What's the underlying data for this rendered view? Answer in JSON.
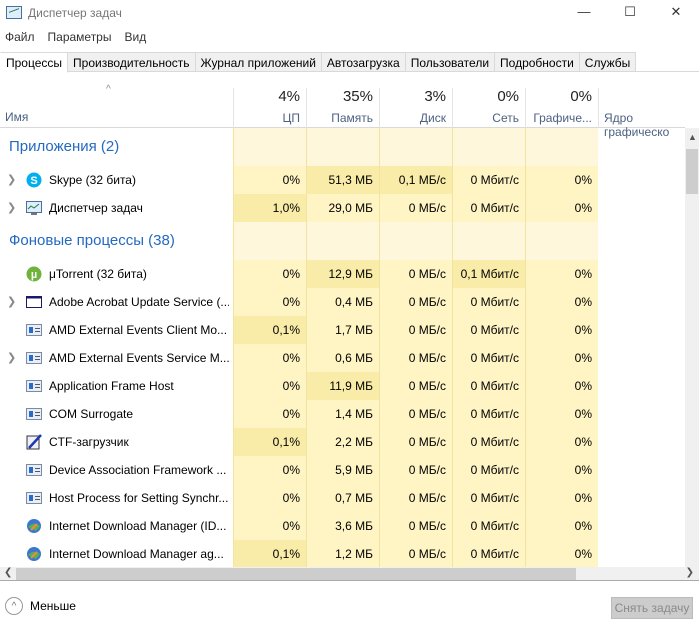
{
  "window": {
    "title": "Диспетчер задач",
    "controls": [
      "—",
      "☐",
      "✕"
    ]
  },
  "menu": [
    "Файл",
    "Параметры",
    "Вид"
  ],
  "tabs": [
    "Процессы",
    "Производительность",
    "Журнал приложений",
    "Автозагрузка",
    "Пользователи",
    "Подробности",
    "Службы"
  ],
  "header": {
    "name": "Имя",
    "sort_arrow": "^",
    "columns": [
      {
        "pct": "4%",
        "label": "ЦП"
      },
      {
        "pct": "35%",
        "label": "Память"
      },
      {
        "pct": "3%",
        "label": "Диск"
      },
      {
        "pct": "0%",
        "label": "Сеть"
      },
      {
        "pct": "0%",
        "label": "Графиче..."
      },
      {
        "pct": "",
        "label": "Ядро графическо"
      }
    ]
  },
  "colors": {
    "cell": "#fff4c4",
    "cell_hot": "#f9eca8",
    "group": "#2469c2"
  },
  "groups": [
    {
      "title": "Приложения (2)",
      "rows": [
        {
          "name": "Skype (32 бита)",
          "icon": "skype-icon",
          "expand": true,
          "v": [
            "0%",
            "51,3 МБ",
            "0,1 МБ/с",
            "0 Мбит/с",
            "0%"
          ],
          "hot": [
            0,
            1,
            1,
            0,
            0
          ]
        },
        {
          "name": "Диспетчер задач",
          "icon": "task-manager-icon",
          "expand": true,
          "v": [
            "1,0%",
            "29,0 МБ",
            "0 МБ/с",
            "0 Мбит/с",
            "0%"
          ],
          "hot": [
            1,
            0,
            0,
            0,
            0
          ]
        }
      ]
    },
    {
      "title": "Фоновые процессы (38)",
      "rows": [
        {
          "name": "μTorrent (32 бита)",
          "icon": "utorrent-icon",
          "expand": false,
          "v": [
            "0%",
            "12,9 МБ",
            "0 МБ/с",
            "0,1 Мбит/с",
            "0%"
          ],
          "hot": [
            0,
            1,
            0,
            1,
            0
          ]
        },
        {
          "name": "Adobe Acrobat Update Service (...",
          "icon": "window-icon",
          "expand": true,
          "v": [
            "0%",
            "0,4 МБ",
            "0 МБ/с",
            "0 Мбит/с",
            "0%"
          ],
          "hot": [
            0,
            0,
            0,
            0,
            0
          ]
        },
        {
          "name": "AMD External Events Client Mo...",
          "icon": "service-icon",
          "expand": false,
          "v": [
            "0,1%",
            "1,7 МБ",
            "0 МБ/с",
            "0 Мбит/с",
            "0%"
          ],
          "hot": [
            1,
            0,
            0,
            0,
            0
          ]
        },
        {
          "name": "AMD External Events Service M...",
          "icon": "service-icon",
          "expand": true,
          "v": [
            "0%",
            "0,6 МБ",
            "0 МБ/с",
            "0 Мбит/с",
            "0%"
          ],
          "hot": [
            0,
            0,
            0,
            0,
            0
          ]
        },
        {
          "name": "Application Frame Host",
          "icon": "service-icon",
          "expand": false,
          "v": [
            "0%",
            "11,9 МБ",
            "0 МБ/с",
            "0 Мбит/с",
            "0%"
          ],
          "hot": [
            0,
            1,
            0,
            0,
            0
          ]
        },
        {
          "name": "COM Surrogate",
          "icon": "service-icon",
          "expand": false,
          "v": [
            "0%",
            "1,4 МБ",
            "0 МБ/с",
            "0 Мбит/с",
            "0%"
          ],
          "hot": [
            0,
            0,
            0,
            0,
            0
          ]
        },
        {
          "name": "CTF-загрузчик",
          "icon": "ctf-icon",
          "expand": false,
          "v": [
            "0,1%",
            "2,2 МБ",
            "0 МБ/с",
            "0 Мбит/с",
            "0%"
          ],
          "hot": [
            1,
            0,
            0,
            0,
            0
          ]
        },
        {
          "name": "Device Association Framework ...",
          "icon": "service-icon",
          "expand": false,
          "v": [
            "0%",
            "5,9 МБ",
            "0 МБ/с",
            "0 Мбит/с",
            "0%"
          ],
          "hot": [
            0,
            0,
            0,
            0,
            0
          ]
        },
        {
          "name": "Host Process for Setting Synchr...",
          "icon": "service-icon",
          "expand": false,
          "v": [
            "0%",
            "0,7 МБ",
            "0 МБ/с",
            "0 Мбит/с",
            "0%"
          ],
          "hot": [
            0,
            0,
            0,
            0,
            0
          ]
        },
        {
          "name": "Internet Download Manager (ID...",
          "icon": "idm-icon",
          "expand": false,
          "v": [
            "0%",
            "3,6 МБ",
            "0 МБ/с",
            "0 Мбит/с",
            "0%"
          ],
          "hot": [
            0,
            0,
            0,
            0,
            0
          ]
        },
        {
          "name": "Internet Download Manager ag...",
          "icon": "idm-agent-icon",
          "expand": false,
          "v": [
            "0,1%",
            "1,2 МБ",
            "0 МБ/с",
            "0 Мбит/с",
            "0%"
          ],
          "hot": [
            1,
            0,
            0,
            0,
            0
          ]
        }
      ]
    }
  ],
  "footer": {
    "less": "Меньше",
    "end_task": "Снять задачу"
  }
}
